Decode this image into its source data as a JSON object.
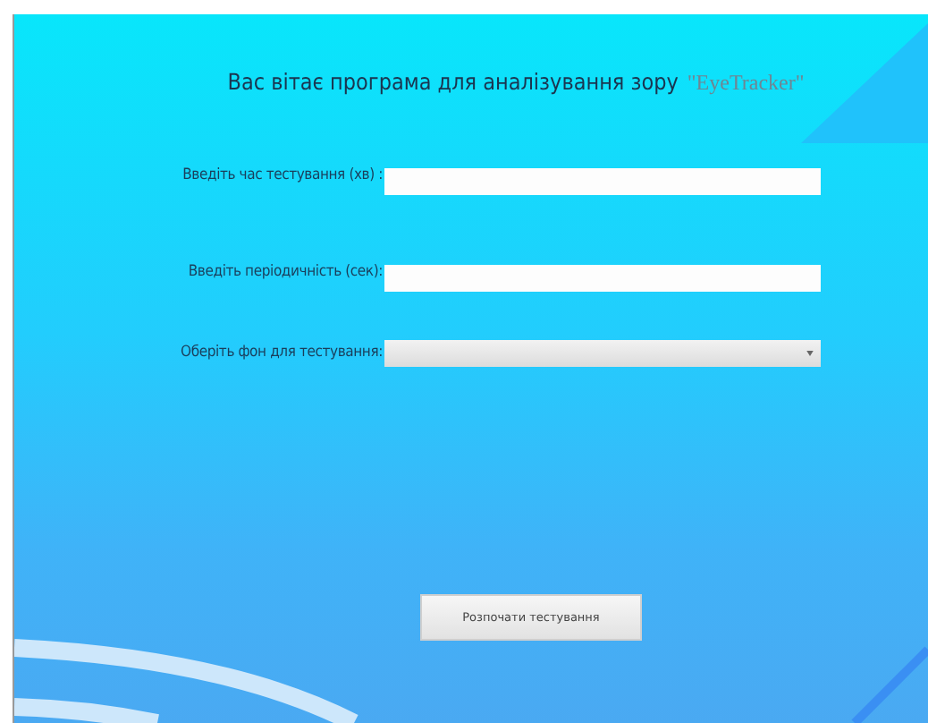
{
  "title": {
    "text": "Вас вітає програма для аналізування зору",
    "app_name": "\"EyeTracker\""
  },
  "fields": [
    {
      "kind": "text",
      "label": "Введіть час тестування (хв) :"
    },
    {
      "kind": "text",
      "label": "Введіть періодичність (сек):"
    },
    {
      "kind": "dropdown",
      "label": "Оберіть фон для тестування:"
    }
  ],
  "start_button": "Розпочати тестування"
}
